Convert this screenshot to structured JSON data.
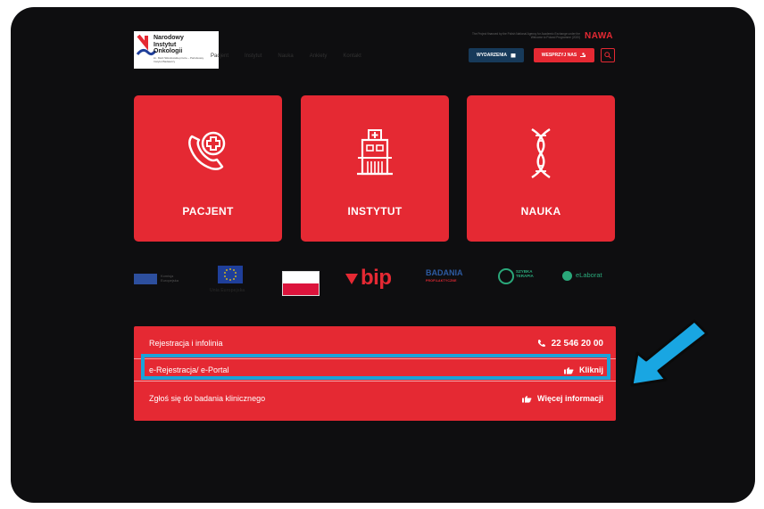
{
  "header": {
    "logo_lines": [
      "Narodowy",
      "Instytut",
      "Onkologii"
    ],
    "logo_subtitle": "im. Marii Skłodowskiej-Curie – Państwowy Instytut Badawczy",
    "nav": [
      "Pacjent",
      "Instytut",
      "Nauka",
      "Ankiety",
      "Kontakt"
    ],
    "nawa_note": "The Project financed by the Polish National Agency for Academic Exchange under the Welcome to Poland Programme (2020)",
    "nawa_logo": "NAWA",
    "events_button": "WYDARZENIA",
    "support_button": "WESPRZYJ NAS"
  },
  "tiles": [
    {
      "label": "PACJENT",
      "icon": "phone-medical-icon"
    },
    {
      "label": "INSTYTUT",
      "icon": "hospital-icon"
    },
    {
      "label": "NAUKA",
      "icon": "dna-icon"
    }
  ],
  "partners": {
    "ec_text": "Komisja Europejska",
    "eu_text": "Unia Europejska",
    "bip": "bip",
    "badania": "BADANIA",
    "badania_sub": "PROFILAKTYCZNE",
    "szybka": "SZYBKA TERAPIA",
    "elaborat": "eLaborat"
  },
  "panel": {
    "rows": [
      {
        "label": "Rejestracja i infolinia",
        "action": "22 546 20 00",
        "icon": "phone-icon"
      },
      {
        "label": "e-Rejestracja/ e-Portal",
        "action": "Kliknij",
        "icon": "pointing-hand-icon"
      },
      {
        "label": "Zgłoś się do badania klinicznego",
        "action": "Więcej informacji",
        "icon": "pointing-hand-icon"
      }
    ]
  },
  "colors": {
    "brand_red": "#e52933",
    "navy": "#173a5a",
    "highlight_blue": "#1aa3d9"
  }
}
